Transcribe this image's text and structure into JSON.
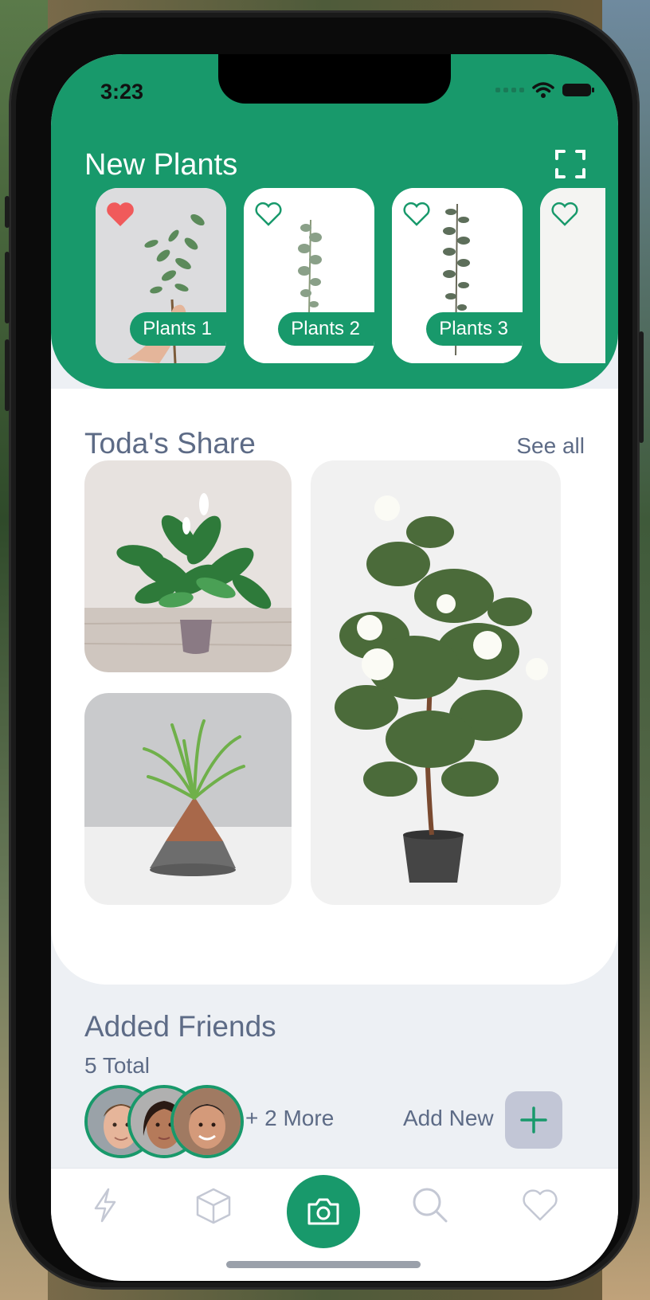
{
  "status_bar": {
    "time": "3:23"
  },
  "header": {
    "title": "New Plants",
    "accent_color": "#18996b",
    "scan_icon": "scan-frame-icon"
  },
  "new_plants": [
    {
      "label": "Plants 1",
      "liked": true
    },
    {
      "label": "Plants 2",
      "liked": false
    },
    {
      "label": "Plants 3",
      "liked": false
    },
    {
      "label": "",
      "liked": false
    }
  ],
  "share": {
    "title": "Toda's Share",
    "see_all": "See all",
    "images": [
      "peace-lily-in-pot",
      "air-plant-on-cone-vase",
      "white-rose-bush-in-pot"
    ]
  },
  "friends": {
    "title": "Added Friends",
    "count": "5 Total",
    "more": "+ 2 More",
    "add_new": "Add New",
    "avatars": [
      "friend-1",
      "friend-2",
      "friend-3"
    ]
  },
  "tabbar": {
    "items": [
      "flash-icon",
      "cube-icon",
      "camera-icon",
      "search-icon",
      "heart-icon"
    ],
    "active": "camera-icon"
  }
}
